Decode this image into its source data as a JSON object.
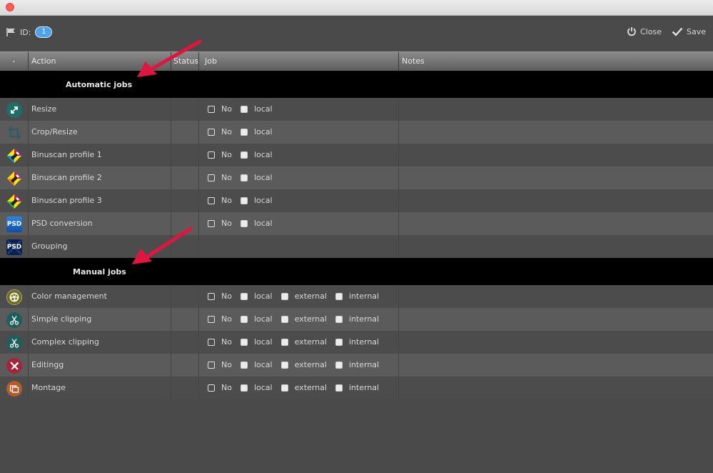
{
  "toolbar": {
    "id_label": "ID:",
    "id_value": "1",
    "close_label": "Close",
    "save_label": "Save"
  },
  "columns": {
    "minus": "-",
    "action": "Action",
    "status": "Status",
    "job": "Job",
    "notes": "Notes"
  },
  "sections": {
    "automatic": "Automatic jobs",
    "manual": "Manual jobs"
  },
  "options": {
    "no": "No",
    "local": "local",
    "external": "external",
    "internal": "internal"
  },
  "automatic_jobs": [
    {
      "label": "Resize",
      "icon": "resize-icon"
    },
    {
      "label": "Crop/Resize",
      "icon": "crop-icon"
    },
    {
      "label": "Binuscan profile 1",
      "icon": "color-profile-icon"
    },
    {
      "label": "Binuscan profile 2",
      "icon": "color-profile-icon"
    },
    {
      "label": "Binuscan profile 3",
      "icon": "color-profile-icon"
    },
    {
      "label": "PSD conversion",
      "icon": "psd-icon",
      "icon_text": "PSD"
    },
    {
      "label": "Grouping",
      "icon": "psd-group-icon",
      "icon_text": "PSD"
    }
  ],
  "manual_jobs": [
    {
      "label": "Color management",
      "icon": "palette-icon"
    },
    {
      "label": "Simple clipping",
      "icon": "scissors-icon"
    },
    {
      "label": "Complex clipping",
      "icon": "scissors-icon"
    },
    {
      "label": "Editingg",
      "icon": "edit-tools-icon"
    },
    {
      "label": "Montage",
      "icon": "montage-icon"
    }
  ],
  "colors": {
    "accent_arrow": "#e0163f",
    "badge": "#4da3ee",
    "section_bg": "#000000"
  }
}
